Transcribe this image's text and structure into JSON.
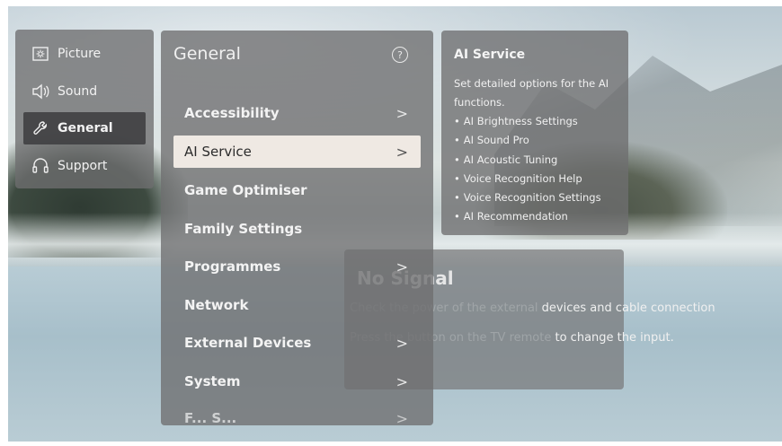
{
  "categories": [
    {
      "label": "Picture",
      "icon": "picture-icon"
    },
    {
      "label": "Sound",
      "icon": "speaker-icon"
    },
    {
      "label": "General",
      "icon": "wrench-icon",
      "active": true
    },
    {
      "label": "Support",
      "icon": "headset-icon"
    }
  ],
  "main": {
    "title": "General",
    "help_icon": "help-icon",
    "items": [
      {
        "label": "Accessibility",
        "chevron": ">"
      },
      {
        "label": "AI Service",
        "chevron": ">",
        "selected": true
      },
      {
        "label": "Game Optimiser",
        "chevron": ""
      },
      {
        "label": "Family Settings",
        "chevron": ""
      },
      {
        "label": "Programmes",
        "chevron": ">"
      },
      {
        "label": "Network",
        "chevron": ""
      },
      {
        "label": "External Devices",
        "chevron": ">"
      },
      {
        "label": "System",
        "chevron": ">"
      },
      {
        "label": "F...  S...",
        "chevron": ">"
      }
    ]
  },
  "info": {
    "title": "AI Service",
    "description": "Set detailed options for the AI functions.",
    "bullets": [
      "AI Brightness Settings",
      "AI Sound Pro",
      "AI Acoustic Tuning",
      "Voice Recognition Help",
      "Voice Recognition Settings",
      "AI Recommendation"
    ]
  },
  "signal": {
    "title": "No Signal",
    "line1_hidden": "Check the power of the external",
    "line1_visible": "devices and cable connection",
    "line2_hidden": "Press the button on the TV remote",
    "line2_visible": "to change the input."
  }
}
